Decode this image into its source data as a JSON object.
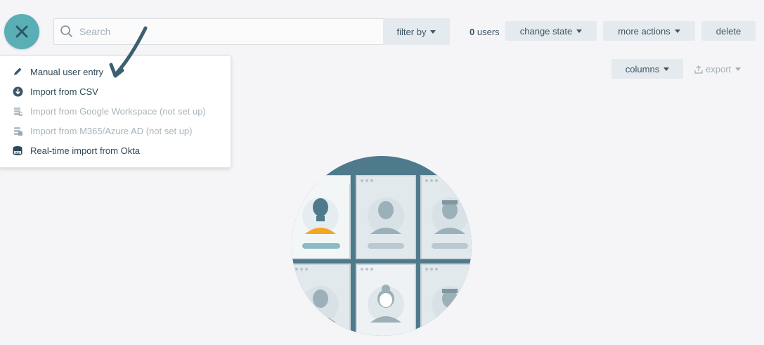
{
  "toolbar": {
    "search_placeholder": "Search",
    "filter_label": "filter by",
    "user_count": "0",
    "user_count_suffix": "users",
    "change_state_label": "change state",
    "more_actions_label": "more actions",
    "delete_label": "delete",
    "columns_label": "columns",
    "export_label": "export"
  },
  "add_menu": {
    "items": [
      {
        "label": "Manual user entry",
        "icon": "pencil-icon",
        "enabled": true
      },
      {
        "label": "Import from CSV",
        "icon": "download-circle-icon",
        "enabled": true
      },
      {
        "label": "Import from Google Workspace (not set up)",
        "icon": "google-workspace-icon",
        "enabled": false
      },
      {
        "label": "Import from M365/Azure AD (not set up)",
        "icon": "office365-icon",
        "enabled": false
      },
      {
        "label": "Real-time import from Okta",
        "icon": "okta-icon",
        "enabled": true
      }
    ]
  },
  "colors": {
    "accent": "#5aaeb5",
    "text": "#3c5666",
    "button_bg": "#e5eaee",
    "disabled_text": "#a8b4bc",
    "illustration_dark": "#4e7a8c",
    "illustration_orange": "#f5a623"
  }
}
